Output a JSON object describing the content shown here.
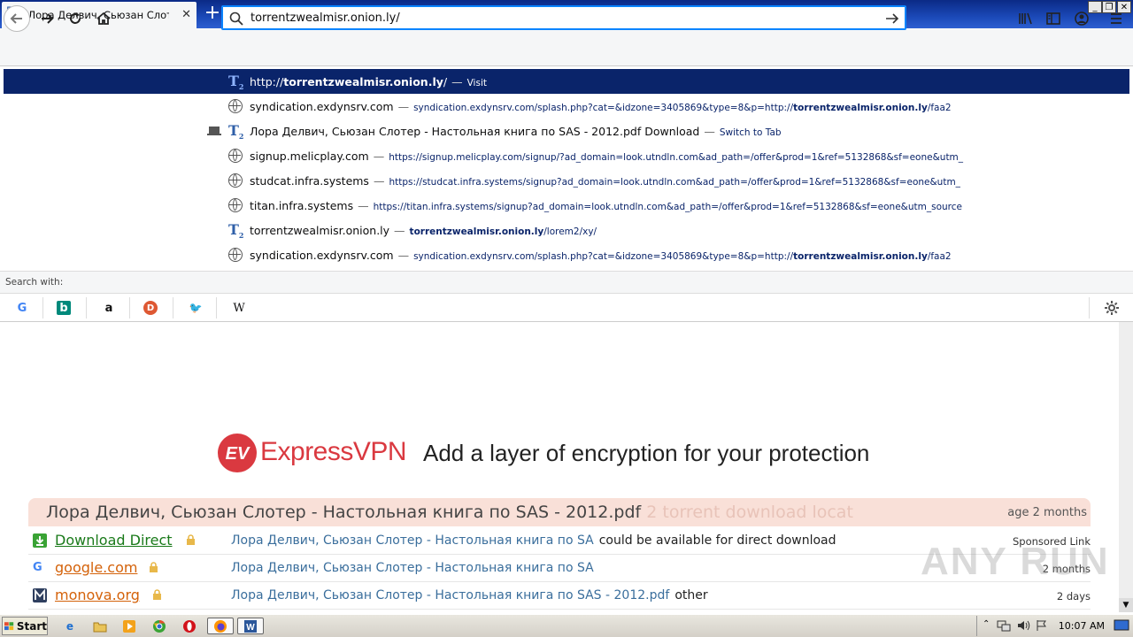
{
  "browser": {
    "tab_title": "Лора Делвич, Сьюзан Слотер - Н",
    "tab_close": "✕",
    "new_tab": "+",
    "window_controls": [
      "_",
      "❐",
      "✕"
    ]
  },
  "urlbar": {
    "value": "torrentzwealmisr.onion.ly/"
  },
  "dropdown": {
    "rows": [
      {
        "icon": "t2",
        "title_plain": "http://",
        "title_bold": "torrentzwealmisr.onion.ly",
        "title_after": "/",
        "sep": "—",
        "action": "Visit",
        "selected": true
      },
      {
        "icon": "globe",
        "title": "syndication.exdynsrv.com",
        "sep": "—",
        "url_before": "syndication.exdynsrv.com/splash.php?cat=&idzone=3405869&type=8&p=http://",
        "url_bold": "torrentzwealmisr.onion.ly",
        "url_after": "/faa2"
      },
      {
        "icon": "t2",
        "title": "Лора Делвич, Сьюзан Слотер - Настольная книга по SAS - 2012.pdf Download",
        "sep": "—",
        "action": "Switch to Tab",
        "switch": true
      },
      {
        "icon": "globe",
        "title": "signup.melicplay.com",
        "sep": "—",
        "url_before": "https://signup.melicplay.com/signup/?ad_domain=look.utndln.com&ad_path=/offer&prod=1&ref=5132868&sf=eone&utm_"
      },
      {
        "icon": "globe",
        "title": "studcat.infra.systems",
        "sep": "—",
        "url_before": "https://studcat.infra.systems/signup?ad_domain=look.utndln.com&ad_path=/offer&prod=1&ref=5132868&sf=eone&utm_"
      },
      {
        "icon": "globe",
        "title": "titan.infra.systems",
        "sep": "—",
        "url_before": "https://titan.infra.systems/signup?ad_domain=look.utndln.com&ad_path=/offer&prod=1&ref=5132868&sf=eone&utm_source"
      },
      {
        "icon": "t2",
        "title": "torrentzwealmisr.onion.ly",
        "sep": "—",
        "url_bold": "torrentzwealmisr.onion.ly",
        "url_after": "/lorem2/xy/"
      },
      {
        "icon": "globe",
        "title": "syndication.exdynsrv.com",
        "sep": "—",
        "url_before": "syndication.exdynsrv.com/splash.php?cat=&idzone=3405869&type=8&p=http://",
        "url_bold": "torrentzwealmisr.onion.ly",
        "url_after": "/faa2"
      }
    ],
    "search_with_label": "Search with:",
    "engines": [
      {
        "name": "google",
        "glyph": "G",
        "color": "#4285f4"
      },
      {
        "name": "bing",
        "glyph": "b",
        "color": "#ffffff"
      },
      {
        "name": "amazon",
        "glyph": "a",
        "color": "#111111"
      },
      {
        "name": "duckduckgo",
        "glyph": "D",
        "color": "#de5833"
      },
      {
        "name": "twitter",
        "glyph": "🐦",
        "color": "#1da1f2"
      },
      {
        "name": "wikipedia",
        "glyph": "W",
        "color": "#222222"
      }
    ]
  },
  "page": {
    "ad_brand": "ExpressVPN",
    "ad_logo_text": "EV",
    "ad_tagline": "Add a layer of encryption for your protection",
    "result_title": "Лора Делвич, Сьюзан Слотер - Настольная книга по SAS - 2012.pdf",
    "result_title_faded": " 2 torrent download locat",
    "result_age": "age 2 months",
    "results": [
      {
        "site": "Download Direct",
        "icon": "download",
        "desc": "Лора Делвич, Сьюзан Слотер - Настольная книга по SA",
        "desc2": "could be available for direct download",
        "right": "Sponsored Link"
      },
      {
        "site": "google.com",
        "icon": "google",
        "desc": "Лора Делвич, Сьюзан Слотер - Настольная книга по SA",
        "desc2": "",
        "right": "2 months"
      },
      {
        "site": "monova.org",
        "icon": "monova",
        "desc": "Лора Делвич, Сьюзан Слотер - Настольная книга по SAS - 2012.pdf",
        "desc2": "other",
        "right": "2 days"
      }
    ],
    "watermark": "ANY RUN"
  },
  "taskbar": {
    "start_label": "Start",
    "clock": "10:07 AM"
  },
  "colors": {
    "selection": "#0a246a",
    "accent": "#0a84ff",
    "expressvpn_red": "#da3940",
    "result_header_bg": "#f9e0d8"
  }
}
